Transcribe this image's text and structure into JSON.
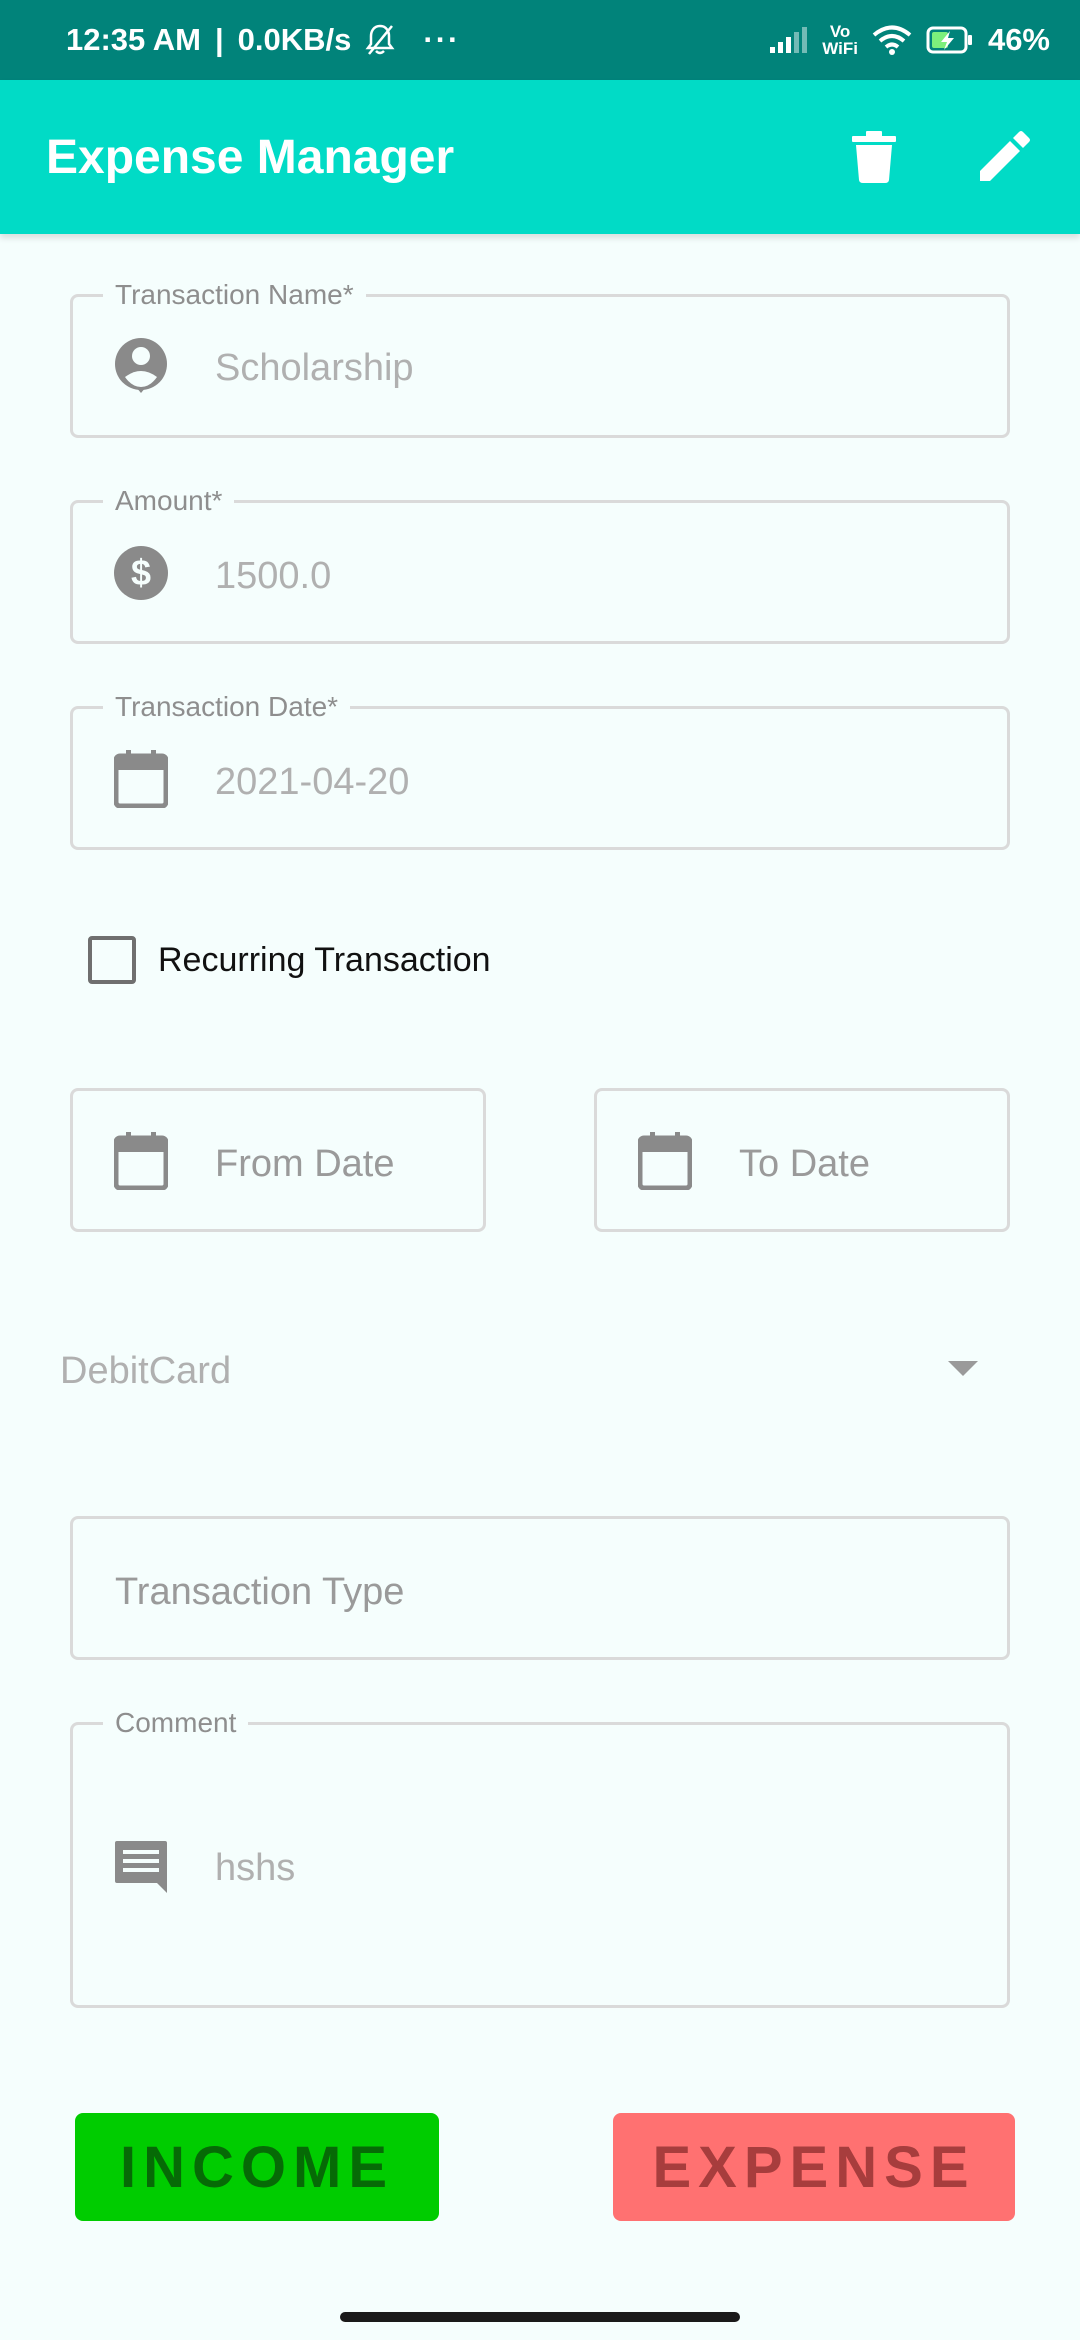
{
  "status_bar": {
    "time": "12:35 AM",
    "separator": "|",
    "speed": "0.0KB/s",
    "more": "···",
    "vowifi_top": "Vo",
    "vowifi_bottom": "WiFi",
    "battery": "46%"
  },
  "app_bar": {
    "title": "Expense Manager"
  },
  "form": {
    "transaction_name": {
      "label": "Transaction Name*",
      "value": "Scholarship",
      "icon": "account-circle-icon"
    },
    "amount": {
      "label": "Amount*",
      "value": "1500.0",
      "icon": "dollar-icon"
    },
    "transaction_date": {
      "label": "Transaction Date*",
      "value": "2021-04-20",
      "icon": "calendar-icon"
    },
    "recurring": {
      "label": "Recurring Transaction",
      "checked": false
    },
    "from_date": {
      "placeholder": "From Date",
      "icon": "calendar-icon"
    },
    "to_date": {
      "placeholder": "To Date",
      "icon": "calendar-icon"
    },
    "payment_method": {
      "value": "DebitCard"
    },
    "transaction_type": {
      "placeholder": "Transaction Type"
    },
    "comment": {
      "label": "Comment",
      "value": "hshs",
      "icon": "comment-icon"
    }
  },
  "buttons": {
    "income": "INCOME",
    "expense": "EXPENSE"
  },
  "colors": {
    "status_bar": "#01837a",
    "app_bar": "#01dbc6",
    "background": "#f5fefd",
    "income_bg": "#00cc00",
    "income_text": "#066a06",
    "expense_bg": "#ff7171",
    "expense_text": "#a73d3d"
  }
}
